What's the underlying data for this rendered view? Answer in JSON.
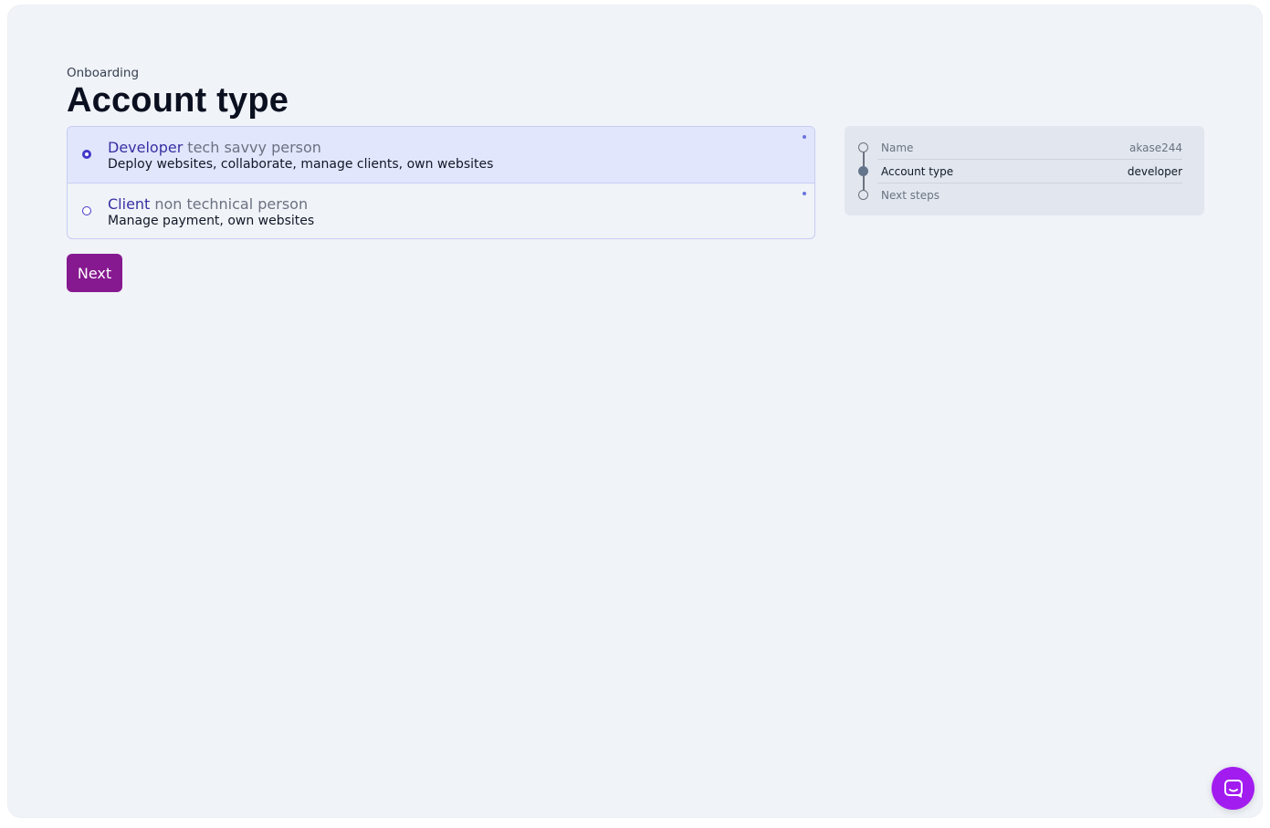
{
  "header": {
    "eyebrow": "Onboarding",
    "title": "Account type"
  },
  "account_options": [
    {
      "title": "Developer",
      "subtitle": "tech savvy person",
      "description": "Deploy websites, collaborate, manage clients, own websites",
      "selected": true
    },
    {
      "title": "Client",
      "subtitle": "non technical person",
      "description": "Manage payment, own websites",
      "selected": false
    }
  ],
  "actions": {
    "next_label": "Next"
  },
  "summary": {
    "steps": [
      {
        "label": "Name",
        "value": "akase244",
        "state": "complete"
      },
      {
        "label": "Account type",
        "value": "developer",
        "state": "current"
      },
      {
        "label": "Next steps",
        "value": "",
        "state": "upcoming"
      }
    ]
  },
  "colors": {
    "accent": "#4338ca",
    "primary_button": "#86198f",
    "chat_button": "#a21cf0",
    "page_background": "#f0f3f8"
  },
  "icons": {
    "chat_launcher": "chat-bubble-icon"
  }
}
